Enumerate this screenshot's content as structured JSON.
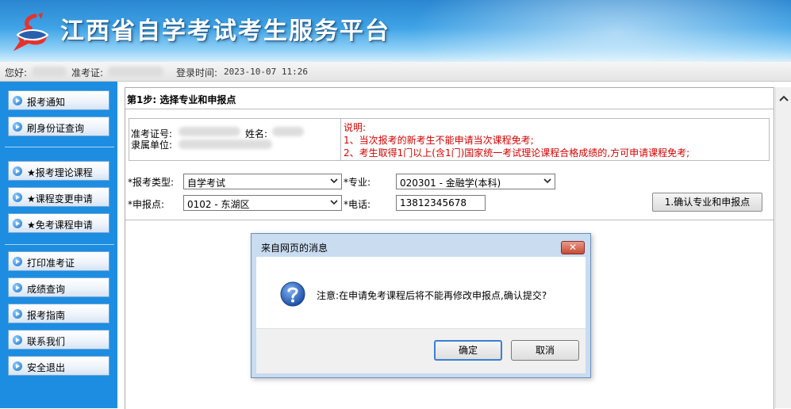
{
  "header": {
    "title": "江西省自学考试考生服务平台"
  },
  "user_bar": {
    "greeting_label": "您好:",
    "ticket_label": "准考证:",
    "login_time_label": "登录时间:",
    "login_time_value": "2023-10-07 11:26"
  },
  "sidebar": {
    "items": [
      {
        "label": "报考通知"
      },
      {
        "label": "刷身份证查询"
      },
      {
        "label": "★报考理论课程"
      },
      {
        "label": "★课程变更申请"
      },
      {
        "label": "★免考课程申请"
      },
      {
        "label": "打印准考证"
      },
      {
        "label": "成绩查询"
      },
      {
        "label": "报考指南"
      },
      {
        "label": "联系我们"
      },
      {
        "label": "安全退出"
      }
    ]
  },
  "main": {
    "step_title": "第1步: 选择专业和申报点",
    "info": {
      "ticket_label": "准考证号:",
      "name_label": "姓名:",
      "unit_label": "隶属单位:"
    },
    "notes": [
      "说明:",
      "1、当次报考的新考生不能申请当次课程免考;",
      "2、考生取得1门以上(含1门)国家统一考试理论课程合格成绩的,方可申请课程免考;"
    ],
    "form": {
      "exam_type_label": "*报考类型:",
      "exam_type_value": "自学考试",
      "major_label": "*专业:",
      "major_value": "020301 - 金融学(本科)",
      "site_label": "*申报点:",
      "site_value": "0102 - 东湖区",
      "phone_label": "*电话:",
      "phone_value": "13812345678",
      "confirm_label": "1.确认专业和申报点"
    }
  },
  "dialog": {
    "title": "来自网页的消息",
    "message": "注意:在申请免考课程后将不能再修改申报点,确认提交?",
    "ok_label": "确定",
    "cancel_label": "取消",
    "close_symbol": "✕"
  }
}
